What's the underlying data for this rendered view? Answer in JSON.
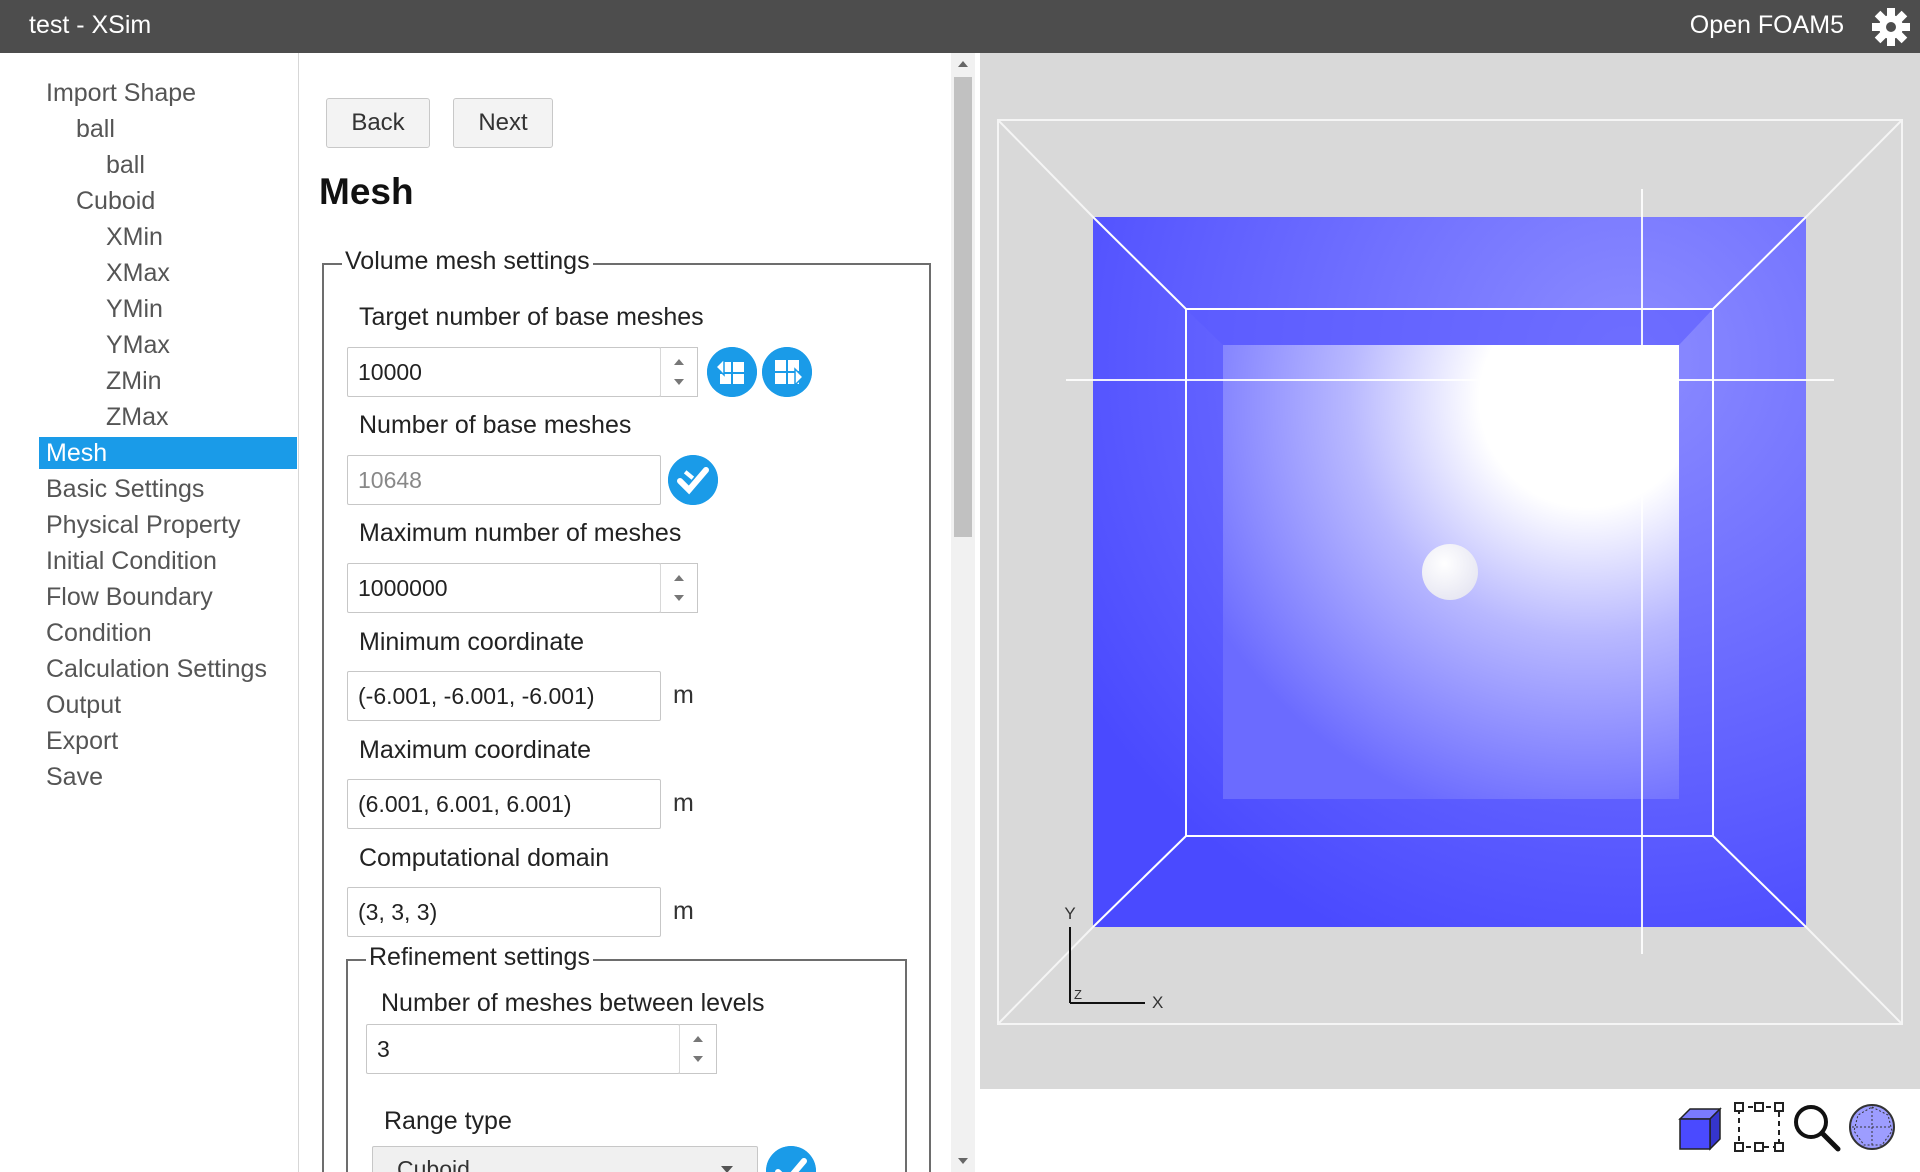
{
  "titlebar": {
    "title": "test - XSim",
    "solver": "Open FOAM5",
    "settings_icon": "gear-icon"
  },
  "sidebar": {
    "active_color": "#1a9be8",
    "items": [
      {
        "label": "Import Shape",
        "level": 0
      },
      {
        "label": "ball",
        "level": 1
      },
      {
        "label": "ball",
        "level": 2
      },
      {
        "label": "Cuboid",
        "level": 1
      },
      {
        "label": "XMin",
        "level": 2
      },
      {
        "label": "XMax",
        "level": 2
      },
      {
        "label": "YMin",
        "level": 2
      },
      {
        "label": "YMax",
        "level": 2
      },
      {
        "label": "ZMin",
        "level": 2
      },
      {
        "label": "ZMax",
        "level": 2
      },
      {
        "label": "Mesh",
        "level": 0,
        "active": true
      },
      {
        "label": "Basic Settings",
        "level": 0
      },
      {
        "label": "Physical Property",
        "level": 0
      },
      {
        "label": "Initial Condition",
        "level": 0
      },
      {
        "label": "Flow Boundary",
        "level": 0
      },
      {
        "label": "Condition",
        "level": 0
      },
      {
        "label": "Calculation Settings",
        "level": 0
      },
      {
        "label": "Output",
        "level": 0
      },
      {
        "label": "Export",
        "level": 0
      },
      {
        "label": "Save",
        "level": 0
      }
    ]
  },
  "nav": {
    "back_label": "Back",
    "next_label": "Next"
  },
  "page": {
    "title": "Mesh"
  },
  "volume_mesh": {
    "legend": "Volume mesh settings",
    "target_label": "Target number of base meshes",
    "target_value": "10000",
    "base_label": "Number of base meshes",
    "base_value": "10648",
    "max_meshes_label": "Maximum number of meshes",
    "max_meshes_value": "1000000",
    "min_coord_label": "Minimum coordinate",
    "min_coord_value": "(-6.001, -6.001, -6.001)",
    "max_coord_label": "Maximum coordinate",
    "max_coord_value": "(6.001, 6.001, 6.001)",
    "domain_label": "Computational domain",
    "domain_value": "(3, 3, 3)",
    "unit": "m"
  },
  "refinement": {
    "legend": "Refinement settings",
    "levels_label": "Number of meshes between levels",
    "levels_value": "3",
    "range_label": "Range type",
    "range_value": "Cuboid"
  },
  "viewport": {
    "axis_x": "X",
    "axis_y": "Y",
    "axis_z": "Z",
    "box_color": "#4a4aff",
    "tools": [
      "cube-view-icon",
      "box-select-icon",
      "zoom-icon",
      "mesh-sphere-icon"
    ]
  }
}
